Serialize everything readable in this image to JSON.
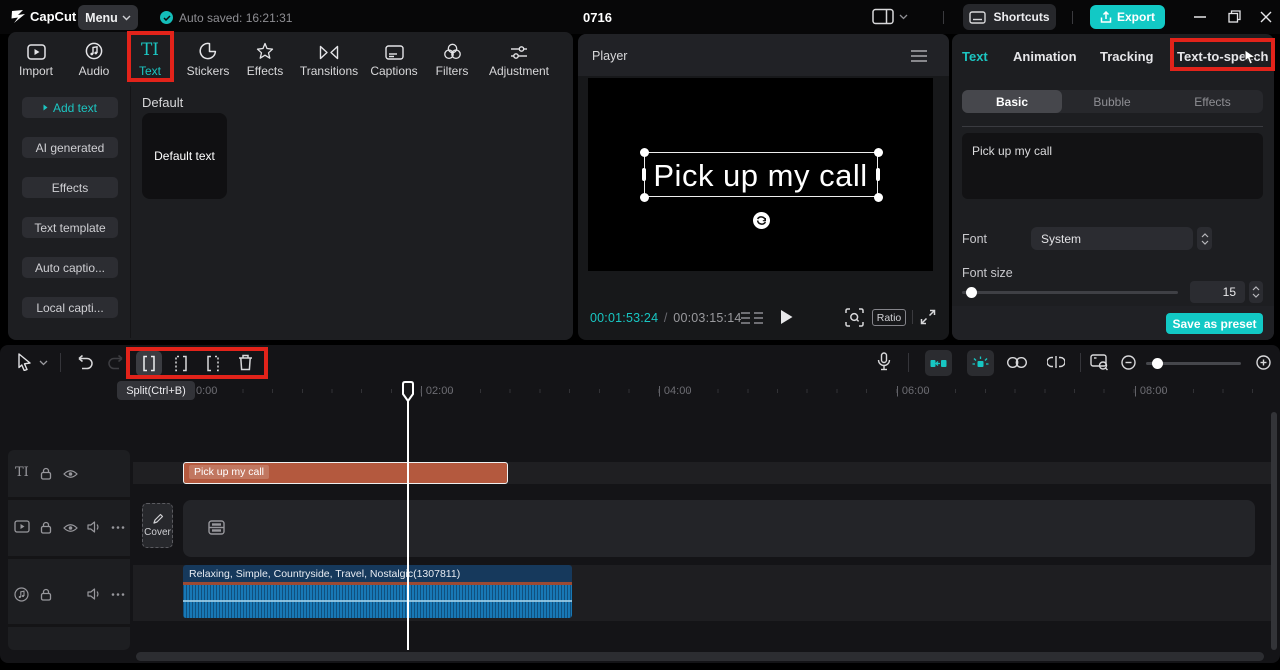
{
  "top_bar": {
    "brand": "CapCut",
    "menu": "Menu",
    "autosave": "Auto saved: 16:21:31",
    "title": "0716",
    "shortcuts": "Shortcuts",
    "export": "Export"
  },
  "media_toolbar": {
    "items": [
      {
        "label": "Import",
        "icon": "import-icon"
      },
      {
        "label": "Audio",
        "icon": "audio-icon"
      },
      {
        "label": "Text",
        "icon": "text-icon",
        "active": true
      },
      {
        "label": "Stickers",
        "icon": "stickers-icon"
      },
      {
        "label": "Effects",
        "icon": "effects-icon"
      },
      {
        "label": "Transitions",
        "icon": "transitions-icon"
      },
      {
        "label": "Captions",
        "icon": "captions-icon"
      },
      {
        "label": "Filters",
        "icon": "filters-icon"
      },
      {
        "label": "Adjustment",
        "icon": "adjustment-icon"
      }
    ]
  },
  "text_panel": {
    "sidebar": [
      {
        "label": "Add text",
        "active": true
      },
      {
        "label": "AI generated"
      },
      {
        "label": "Effects"
      },
      {
        "label": "Text template"
      },
      {
        "label": "Auto captio..."
      },
      {
        "label": "Local capti..."
      }
    ],
    "section_title": "Default",
    "card_label": "Default text"
  },
  "player": {
    "title": "Player",
    "overlay_text": "Pick up my call",
    "current_time": "00:01:53:24",
    "separator": "/",
    "total_time": "00:03:15:14",
    "ratio": "Ratio"
  },
  "inspector": {
    "tabs": [
      "Text",
      "Animation",
      "Tracking",
      "Text-to-speech"
    ],
    "active_tab": "Text",
    "subtabs": [
      "Basic",
      "Bubble",
      "Effects"
    ],
    "active_subtab": "Basic",
    "text_value": "Pick up my call",
    "font_label": "Font",
    "font_value": "System",
    "font_size_label": "Font size",
    "font_size_value": "15",
    "save_preset": "Save as preset"
  },
  "timeline": {
    "tooltip": "Split(Ctrl+B)",
    "ruler": [
      "0:00",
      "| 02:00",
      "| 04:00",
      "| 06:00",
      "| 08:00"
    ],
    "text_clip": "Pick up my call",
    "audio_clip": "Relaxing, Simple, Countryside, Travel, Nostalgic(1307811)",
    "cover": "Cover"
  },
  "colors": {
    "accent": "#13c8c3",
    "annotation": "#e2231a",
    "text_clip_color": "#b4593e",
    "audio_clip_color": "#1878b5"
  }
}
